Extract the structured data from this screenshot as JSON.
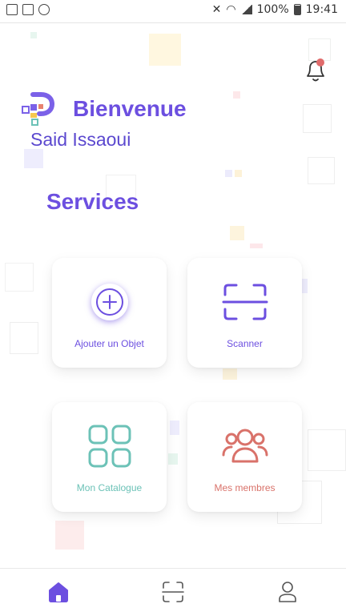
{
  "status_bar": {
    "battery": "100%",
    "time": "19:41"
  },
  "header": {
    "welcome": "Bienvenue",
    "user_name": "Said Issaoui"
  },
  "section_title": "Services",
  "cards": [
    {
      "label": "Ajouter un Objet",
      "icon": "add-circle-icon",
      "color": "#6c4fe0"
    },
    {
      "label": "Scanner",
      "icon": "scan-icon",
      "color": "#6c4fe0"
    },
    {
      "label": "Mon Catalogue",
      "icon": "grid-icon",
      "color": "#6cc2b7"
    },
    {
      "label": "Mes membres",
      "icon": "members-icon",
      "color": "#d9726a"
    }
  ],
  "bottom_nav": [
    {
      "name": "home",
      "icon": "home-icon",
      "active": true
    },
    {
      "name": "scan",
      "icon": "scan-icon",
      "active": false
    },
    {
      "name": "profile",
      "icon": "person-icon",
      "active": false
    }
  ],
  "colors": {
    "accent": "#6c4fe0",
    "teal": "#6cc2b7",
    "coral": "#d9726a"
  }
}
